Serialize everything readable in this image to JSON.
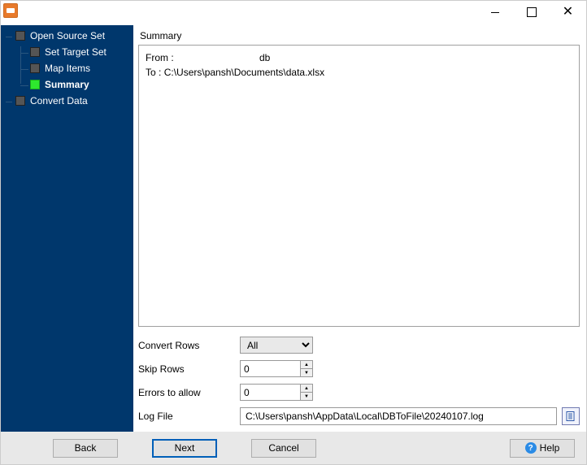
{
  "sidebar": {
    "items": [
      {
        "label": "Open Source Set"
      },
      {
        "label": "Set Target Set"
      },
      {
        "label": "Map Items"
      },
      {
        "label": "Summary",
        "active": true
      },
      {
        "label": "Convert Data"
      }
    ]
  },
  "summary": {
    "title": "Summary",
    "from_label": "From :",
    "from_value": "db",
    "to_label": "To :",
    "to_value": "C:\\Users\\pansh\\Documents\\data.xlsx"
  },
  "options": {
    "convert_rows_label": "Convert Rows",
    "convert_rows_value": "All",
    "skip_rows_label": "Skip Rows",
    "skip_rows_value": "0",
    "errors_label": "Errors to allow",
    "errors_value": "0",
    "logfile_label": "Log File",
    "logfile_value": "C:\\Users\\pansh\\AppData\\Local\\DBToFile\\20240107.log"
  },
  "buttons": {
    "back": "Back",
    "next": "Next",
    "cancel": "Cancel",
    "help": "Help"
  }
}
